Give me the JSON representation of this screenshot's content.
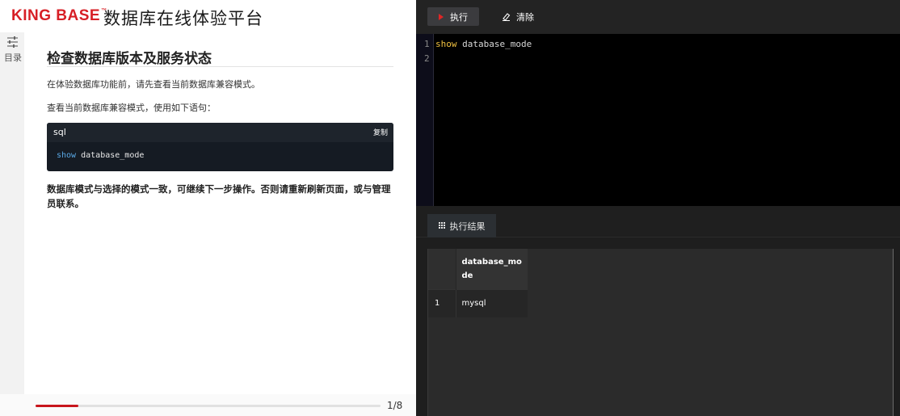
{
  "header": {
    "logo_text": "KING BASE",
    "logo_tm": "™",
    "title": "数据库在线体验平台"
  },
  "toc": {
    "icon": "sliders-icon",
    "label": "目录"
  },
  "lesson": {
    "heading": "检查数据库版本及服务状态",
    "para1": "在体验数据库功能前，请先查看当前数据库兼容模式。",
    "para2": "查看当前数据库兼容模式，使用如下语句：",
    "code": {
      "lang": "sql",
      "copy_label": "复制",
      "keyword": "show",
      "rest": " database_mode"
    },
    "para3": "数据库模式与选择的模式一致，可继续下一步操作。否则请重新刷新页面，或与管理员联系。"
  },
  "footer": {
    "progress": 0.125,
    "page_indicator": "1/8",
    "progress_color": "#c8161d"
  },
  "toolbar": {
    "run_label": "执行",
    "clear_label": "清除"
  },
  "editor": {
    "line_numbers": [
      "1",
      "2"
    ],
    "line1_keyword": "show",
    "line1_rest": " database_mode"
  },
  "results": {
    "tab_label": "执行结果",
    "columns": [
      "database_mode"
    ],
    "rows": [
      {
        "index": "1",
        "values": [
          "mysql"
        ]
      }
    ]
  }
}
